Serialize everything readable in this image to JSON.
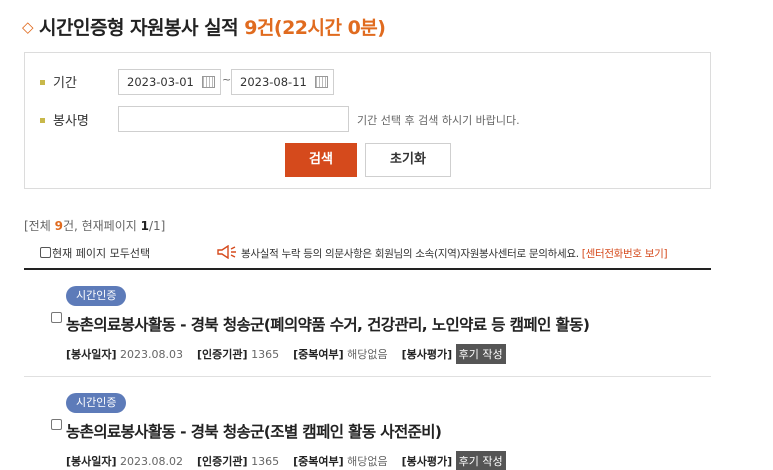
{
  "header": {
    "title": "시간인증형 자원봉사 실적",
    "count": "9건(22시간 0분)"
  },
  "search": {
    "period_label": "기간",
    "start_date": "2023-03-01",
    "tilde": "~",
    "end_date": "2023-08-11",
    "name_label": "봉사명",
    "name_value": "",
    "hint": "기간 선택 후 검색 하시기 바랍니다.",
    "search_button": "검색",
    "reset_button": "초기화"
  },
  "summary": {
    "prefix": "[전체 ",
    "total": "9",
    "middle": "건, 현재페이지 ",
    "page": "1",
    "suffix": "/1]"
  },
  "toolbar": {
    "select_all": "현재 페이지 모두선택",
    "notice": "봉사실적 누락 등의 의문사항은 회원님의 소속(지역)자원봉사센터로 문의하세요.",
    "notice_link": "[센터전화번호 보기]"
  },
  "colors": {
    "accent": "#e06b1f",
    "search_button_bg": "#d54a1c",
    "badge_bg": "#5d7bb9"
  },
  "items": [
    {
      "badge": "시간인증",
      "title": "농촌의료봉사활동 - 경북 청송군(폐의약품 수거, 건강관리, 노인약료 등 캠페인 활동)",
      "date_label": "[봉사일자]",
      "date": "2023.08.03",
      "org_label": "[인증기관]",
      "org": "1365",
      "dup_label": "[중복여부]",
      "dup": "해당없음",
      "eval_label": "[봉사평가]",
      "eval_button": "후기 작성"
    },
    {
      "badge": "시간인증",
      "title": "농촌의료봉사활동 - 경북 청송군(조별 캠페인 활동 사전준비)",
      "date_label": "[봉사일자]",
      "date": "2023.08.02",
      "org_label": "[인증기관]",
      "org": "1365",
      "dup_label": "[중복여부]",
      "dup": "해당없음",
      "eval_label": "[봉사평가]",
      "eval_button": "후기 작성"
    }
  ]
}
